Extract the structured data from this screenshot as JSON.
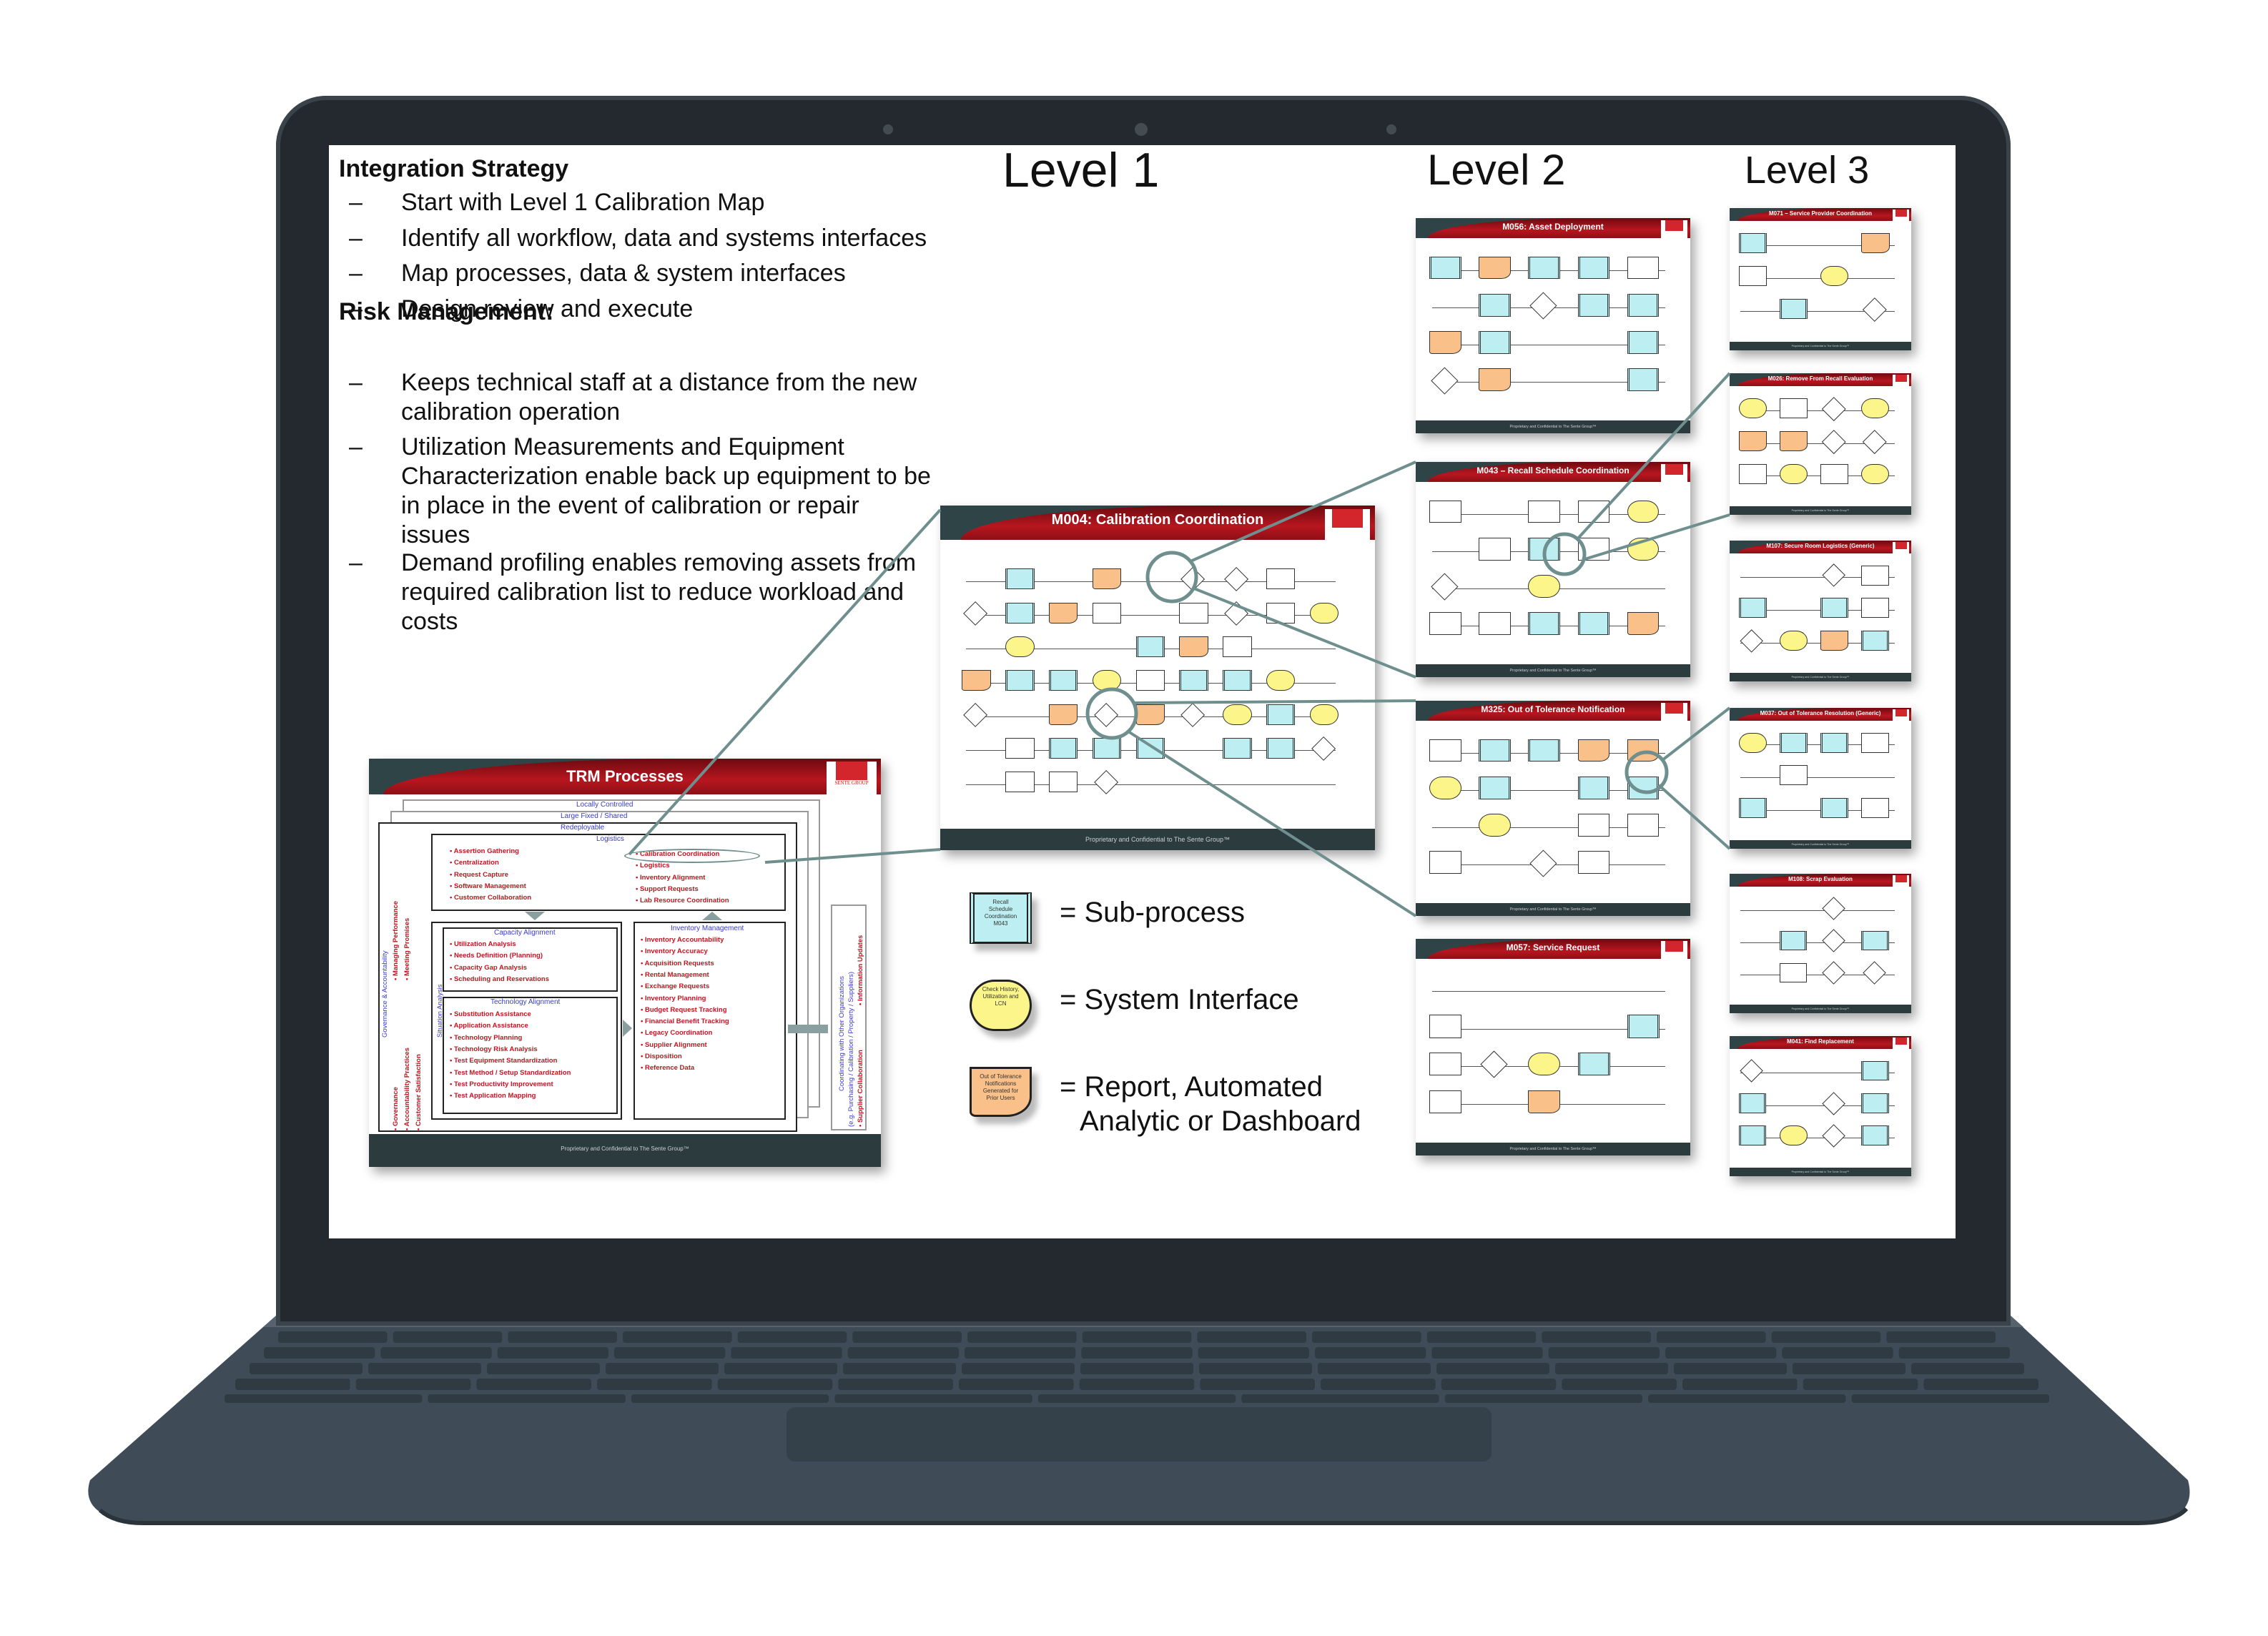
{
  "left_panel": {
    "heading1": "Integration Strategy",
    "items1": [
      [
        "Start with Level 1 Calibration Map"
      ],
      [
        "Identify all workflow, data and systems interfaces"
      ],
      [
        "Map processes, data & system interfaces"
      ],
      [
        "Design review and execute"
      ]
    ],
    "heading2": "Risk Management:",
    "items2": [
      [
        "Keeps technical staff at a distance from the new",
        "calibration operation"
      ],
      [
        "Utilization Measurements and Equipment",
        "Characterization enable back up equipment to be",
        "in place in the event of calibration or repair",
        "issues"
      ],
      [
        "Demand profiling enables removing assets from",
        "required calibration list to reduce workload and",
        "costs"
      ]
    ],
    "dash": "–"
  },
  "levels": [
    "Level 1",
    "Level 2",
    "Level 3"
  ],
  "common": {
    "footer": "Proprietary and Confidential to The Sente Group™",
    "logo": "SENTE GROUP",
    "logo_tagline": "What's next in test"
  },
  "trm": {
    "title": "TRM Processes",
    "layers": [
      "Locally Controlled",
      "Large Fixed / Shared",
      "Redeployable"
    ],
    "logistics": {
      "label": "Logistics",
      "left": [
        "Assertion Gathering",
        "Centralization",
        "Request Capture",
        "Software Management",
        "Customer Collaboration"
      ],
      "right": [
        "Calibration Coordination",
        "Logistics",
        "Inventory Alignment",
        "Support Requests",
        "Lab Resource Coordination"
      ]
    },
    "capacity": {
      "label": "Capacity Alignment",
      "items": [
        "Utilization Analysis",
        "Needs Definition (Planning)",
        "Capacity Gap Analysis",
        "Scheduling and Reservations"
      ]
    },
    "technology": {
      "label": "Technology Alignment",
      "items": [
        "Substitution Assistance",
        "Application Assistance",
        "Technology Planning",
        "Technology Risk Analysis",
        "Test Equipment Standardization",
        "Test Method / Setup Standardization",
        "Test Productivity Improvement",
        "Test Application Mapping"
      ]
    },
    "inventory": {
      "label": "Inventory Management",
      "items": [
        "Inventory Accountability",
        "Inventory Accuracy",
        "Acquisition Requests",
        "Rental Management",
        "Exchange Requests",
        "Inventory Planning",
        "Budget Request Tracking",
        "Financial Benefit Tracking",
        "Legacy Coordination",
        "Supplier Alignment",
        "Disposition",
        "Reference Data"
      ]
    },
    "governance": {
      "label": "Governance & Accountability",
      "items_a": [
        "• Governance",
        "• Accountability Practices",
        "• Customer Satisfaction"
      ],
      "items_b": [
        "• Managing Performance",
        "• Meeting Promises"
      ]
    },
    "situation": "Situation Analysis",
    "coordinating": {
      "label": "Coordinating with Other Organizations",
      "sub": "(e.g. Purchasing / Calibration / Property / Suppliers)",
      "items": [
        "• Supplier Collaboration",
        "• Information Updates"
      ]
    }
  },
  "level1": {
    "title": "M004: Calibration Coordination"
  },
  "level2": [
    {
      "title": "M056: Asset Deployment"
    },
    {
      "title": "M043 – Recall Schedule Coordination"
    },
    {
      "title": "M325: Out of Tolerance Notification"
    },
    {
      "title": "M057: Service Request"
    }
  ],
  "level3": [
    {
      "title": "M071 – Service Provider Coordination"
    },
    {
      "title": "M026: Remove From Recall Evaluation"
    },
    {
      "title": "M107: Secure Room Logistics (Generic)"
    },
    {
      "title": "M037: Out of Tolerance Resolution (Generic)"
    },
    {
      "title": "M108: Scrap Evaluation"
    },
    {
      "title": "M041: Find Replacement"
    }
  ],
  "legend": [
    {
      "shape": "sub-process",
      "sample": "Recall Schedule Coordination M043",
      "label": "= Sub-process",
      "color": "#bdeff2"
    },
    {
      "shape": "system-interface",
      "sample": "Check History, Utilization and LCN",
      "label": "= System Interface",
      "color": "#fbf58a"
    },
    {
      "shape": "report",
      "sample": "Out of Tolerance Notifications Generated for Prior Users",
      "label": "= Report, Automated",
      "label2": "Analytic or Dashboard",
      "color": "#f9c089"
    }
  ],
  "colors": {
    "accent_red": "#b8161f",
    "connector": "#6f8f8f",
    "laptop": "#23292e",
    "laptop_base": "#3f4c57"
  }
}
